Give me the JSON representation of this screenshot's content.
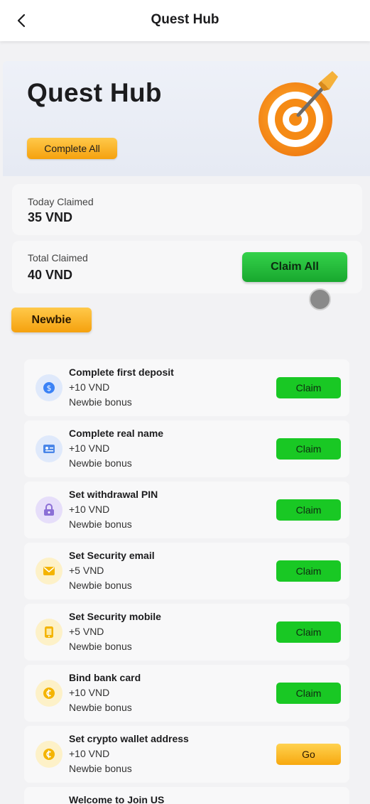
{
  "header": {
    "title": "Quest Hub",
    "back_icon": "chevron-left-icon"
  },
  "hero": {
    "title": "Quest Hub",
    "complete_all_label": "Complete All",
    "illustration": "target-dart-icon"
  },
  "stats": {
    "today": {
      "label": "Today Claimed",
      "value": "35 VND"
    },
    "total": {
      "label": "Total Claimed",
      "value": "40 VND"
    },
    "claim_all_label": "Claim All"
  },
  "tabs": {
    "active": "Newbie"
  },
  "tasks": [
    {
      "title": "Complete first deposit",
      "reward": "+10 VND",
      "subtitle": "Newbie bonus",
      "action": "Claim",
      "icon": "dollar-coin-icon",
      "icon_bg": "#dfe9fb",
      "icon_fg": "#3b82f6"
    },
    {
      "title": "Complete real name",
      "reward": "+10 VND",
      "subtitle": "Newbie bonus",
      "action": "Claim",
      "icon": "id-card-icon",
      "icon_bg": "#dfe9fb",
      "icon_fg": "#4a86e8"
    },
    {
      "title": "Set withdrawal PIN",
      "reward": "+10 VND",
      "subtitle": "Newbie bonus",
      "action": "Claim",
      "icon": "lock-icon",
      "icon_bg": "#e6defa",
      "icon_fg": "#8b6fd6"
    },
    {
      "title": "Set Security email",
      "reward": "+5 VND",
      "subtitle": "Newbie bonus",
      "action": "Claim",
      "icon": "mail-icon",
      "icon_bg": "#fdf1c8",
      "icon_fg": "#f4b400"
    },
    {
      "title": "Set Security mobile",
      "reward": "+5 VND",
      "subtitle": "Newbie bonus",
      "action": "Claim",
      "icon": "phone-icon",
      "icon_bg": "#fdf1c8",
      "icon_fg": "#f4b400"
    },
    {
      "title": "Bind bank card",
      "reward": "+10 VND",
      "subtitle": "Newbie bonus",
      "action": "Claim",
      "icon": "coin-icon",
      "icon_bg": "#fdf1c8",
      "icon_fg": "#f4b400"
    },
    {
      "title": "Set crypto wallet address",
      "reward": "+10 VND",
      "subtitle": "Newbie bonus",
      "action": "Go",
      "icon": "coin-icon",
      "icon_bg": "#fdf1c8",
      "icon_fg": "#f4b400"
    },
    {
      "title": "Welcome to Join US",
      "reward": "",
      "subtitle": "",
      "action": "",
      "icon": "",
      "icon_bg": "",
      "icon_fg": ""
    }
  ],
  "colors": {
    "claim_green": "#19c824",
    "go_orange": "#f7a80f",
    "accent_orange": "#f5a10e"
  }
}
